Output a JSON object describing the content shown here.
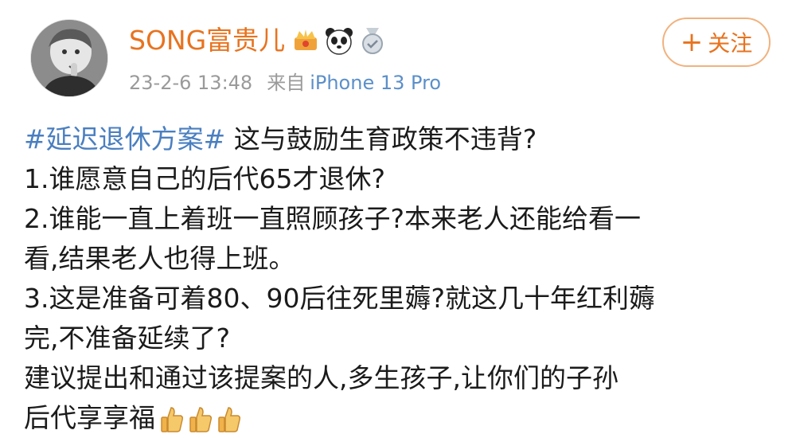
{
  "post": {
    "author": {
      "name": "SONG富贵儿",
      "badges": [
        "crown-badge-icon",
        "panda-badge-icon",
        "medal-badge-icon"
      ]
    },
    "meta": {
      "date": "23-2-6 13:48",
      "source_prefix": "来自",
      "device": "iPhone 13 Pro"
    },
    "follow_button": {
      "label": "关注"
    },
    "content": {
      "hashtag": "#延迟退休方案#",
      "line1_rest": " 这与鼓励生育政策不违背?",
      "line2": "1.谁愿意自己的后代65才退休?",
      "line3": "2.谁能一直上着班一直照顾孩子?本来老人还能给看一",
      "line4": "看,结果老人也得上班。",
      "line5": "3.这是准备可着80、90后往死里薅?就这几十年红利薅",
      "line6": "完,不准备延续了?",
      "line7": "建议提出和通过该提案的人,多生孩子,让你们的子孙",
      "line8": "后代享享福"
    }
  },
  "colors": {
    "username": "#e8731f",
    "hashtag": "#4a7fc0",
    "meta": "#9a9a9a",
    "device": "#5b8fc9",
    "follow_border": "#f1b27e"
  }
}
